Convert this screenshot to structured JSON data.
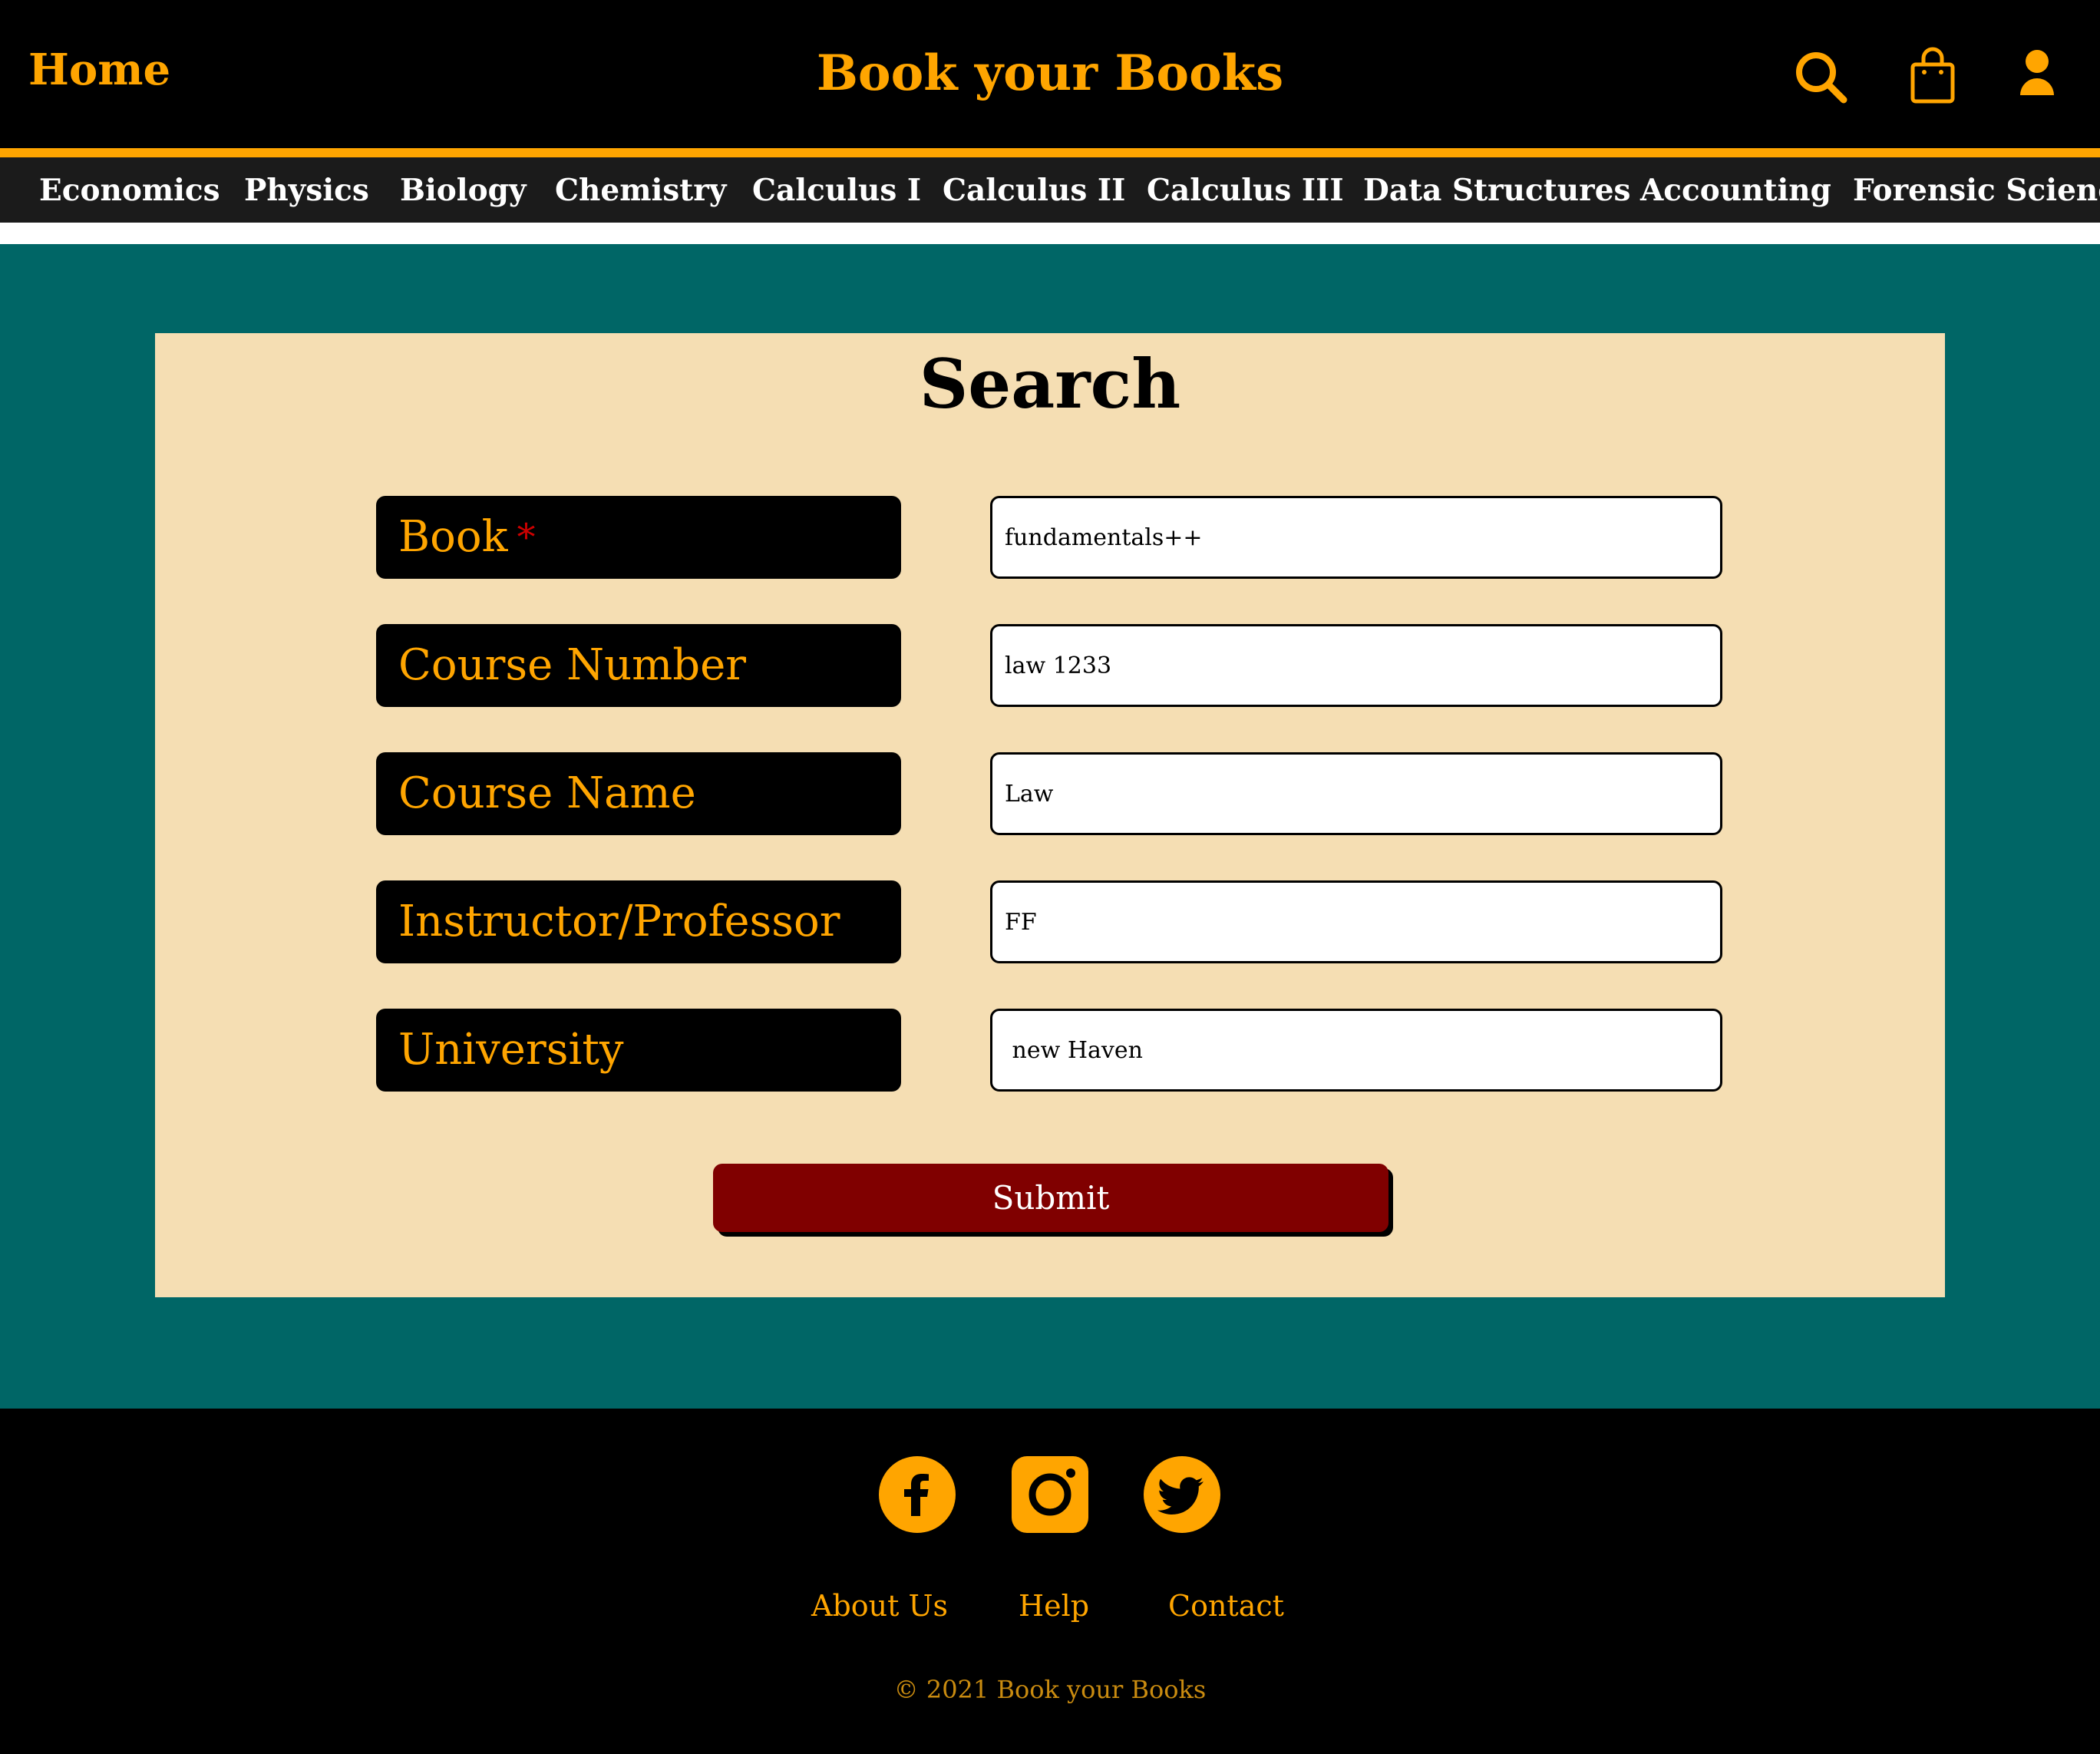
{
  "header": {
    "home_label": "Home",
    "site_title": "Book your Books",
    "icons": [
      "search-icon",
      "shopping-bag-icon",
      "user-icon"
    ]
  },
  "categories": [
    "Economics",
    "Physics",
    "Biology",
    "Chemistry",
    "Calculus I",
    "Calculus II",
    "Calculus III",
    "Data Structures",
    "Accounting",
    "Forensic Science"
  ],
  "search": {
    "title": "Search",
    "fields": [
      {
        "label": "Book",
        "required_mark": "*",
        "value": "fundamentals++"
      },
      {
        "label": "Course Number",
        "value": "law 1233"
      },
      {
        "label": "Course Name",
        "value": "Law"
      },
      {
        "label": "Instructor/Professor",
        "value": "FF"
      },
      {
        "label": "University",
        "value": " new Haven"
      }
    ],
    "submit_label": "Submit"
  },
  "footer": {
    "social_icons": [
      "facebook-icon",
      "instagram-icon",
      "twitter-icon"
    ],
    "links": [
      "About Us",
      "Help",
      "Contact"
    ],
    "copyright": "© 2021 Book your Books"
  },
  "colors": {
    "accent": "#ffa500",
    "header_bg": "#000000",
    "nav_bg": "#1b1b1b",
    "main_bg": "#006666",
    "card_bg": "#f5deb3",
    "submit_bg": "#800000",
    "required": "#cc0000"
  }
}
